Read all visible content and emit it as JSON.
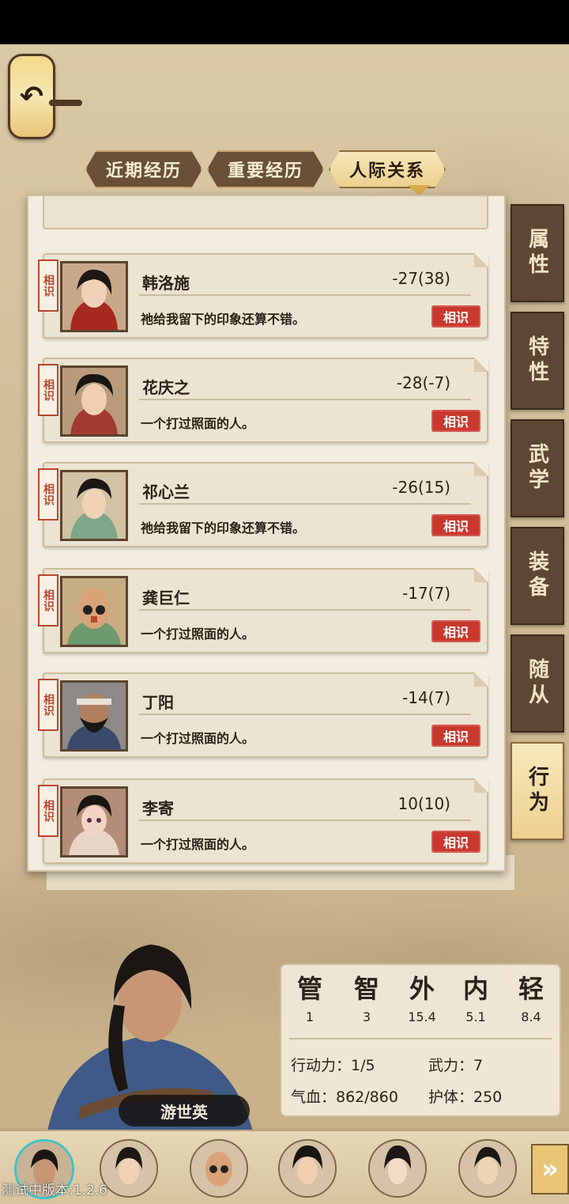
{
  "tabs": [
    "近期经历",
    "重要经历",
    "人际关系"
  ],
  "active_tab": 2,
  "relations": [
    {
      "name": "韩洛施",
      "score": "-27(38)",
      "desc": "祂给我留下的印象还算不错。",
      "tag": "相识",
      "badge": "相识"
    },
    {
      "name": "花庆之",
      "score": "-28(-7)",
      "desc": "一个打过照面的人。",
      "tag": "相识",
      "badge": "相识"
    },
    {
      "name": "祁心兰",
      "score": "-26(15)",
      "desc": "祂给我留下的印象还算不错。",
      "tag": "相识",
      "badge": "相识"
    },
    {
      "name": "龚巨仁",
      "score": "-17(7)",
      "desc": "一个打过照面的人。",
      "tag": "相识",
      "badge": "相识"
    },
    {
      "name": "丁阳",
      "score": "-14(7)",
      "desc": "一个打过照面的人。",
      "tag": "相识",
      "badge": "相识"
    },
    {
      "name": "李寄",
      "score": "10(10)",
      "desc": "一个打过照面的人。",
      "tag": "相识",
      "badge": "相识"
    }
  ],
  "side_tabs": [
    "属性",
    "特性",
    "武学",
    "装备",
    "随从",
    "行为"
  ],
  "active_side_tab": 5,
  "hero_name": "游世英",
  "stats": {
    "columns": [
      {
        "label": "管",
        "value": "1"
      },
      {
        "label": "智",
        "value": "3"
      },
      {
        "label": "外",
        "value": "15.4"
      },
      {
        "label": "内",
        "value": "5.1"
      },
      {
        "label": "轻",
        "value": "8.4"
      }
    ],
    "action": "行动力：1/5",
    "force": "武力：7",
    "hp": "气血：862/860",
    "armor": "护体：250"
  },
  "back_icon": "undo-arrow-icon",
  "next_icon": "double-chevron-right-icon",
  "version": "测试中版本:1.2.6"
}
